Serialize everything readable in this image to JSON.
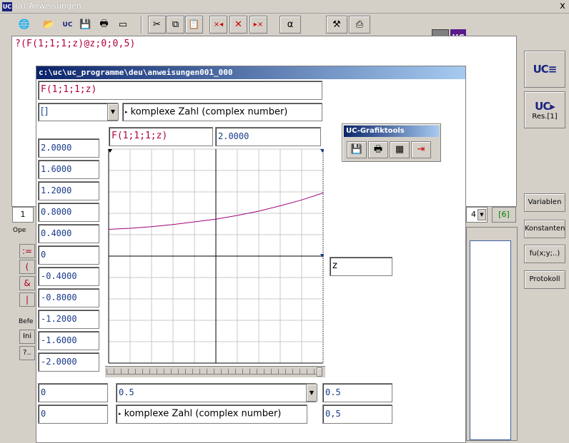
{
  "window": {
    "title": "(a):Anweisungen",
    "close": "x",
    "logo": "UC"
  },
  "toolbar": {
    "globe": "🌐",
    "open": "📂",
    "uc_open": "UC",
    "save": "💾",
    "print": "🖶",
    "screen": "▭",
    "cut": "✂",
    "copy": "⧉",
    "paste": "📋",
    "del_left": "×◂",
    "del_mid": "✕",
    "del_right": "▸×",
    "alpha": "α",
    "tools": "⚒",
    "cam": "⎙"
  },
  "expression": "?(F(1;1;1;z)@z;0;0,5)",
  "side": {
    "uc_top": "UC≡",
    "uc_res": "UC▸",
    "res_label": "Res.[1]",
    "variablen": "Variablen",
    "konstanten": "Konstanten",
    "fu": "fu(x;y;..)",
    "protokoll": "Protokoll"
  },
  "background": {
    "index": "1",
    "ope": "Ope",
    "befe": "Befe",
    "ini": "Ini",
    "q": "?..",
    "assign": ":=",
    "paren": "(",
    "amp": "&",
    "bar": "|",
    "combo_value": "4",
    "bracket6": "[6]"
  },
  "dialog": {
    "title": "c:\\uc\\uc_programme\\deu\\anweisungen001_000",
    "func": "F(1;1;1;z)",
    "type_combo": "[]",
    "type_desc": "komplexe Zahl (complex number)",
    "plot_func": "F(1;1;1;z)",
    "plot_value": "2.0000",
    "y_labels": [
      "2.0000",
      "1.6000",
      "1.2000",
      "0.8000",
      "0.4000",
      "0",
      "-0.4000",
      "-0.8000",
      "-1.2000",
      "-1.6000",
      "-2.0000"
    ],
    "x_var": "z",
    "xmin": "0",
    "xmax_combo": "0.5",
    "xmax": "0.5",
    "row2_left": "0",
    "row2_desc": "komplexe Zahl (complex number)",
    "row2_right": "0,5"
  },
  "grafiktools": {
    "title": "UC-Grafiktools",
    "save": "💾",
    "print": "🖶",
    "table": "▦",
    "exit": "⇥"
  },
  "colors": {
    "curve": "#a0007a",
    "grid": "#c8c8c8",
    "axis": "#000000",
    "accent": "#0a246a"
  },
  "chart_data": {
    "type": "line",
    "x": [
      0,
      0.05,
      0.1,
      0.15,
      0.2,
      0.25,
      0.3,
      0.35,
      0.4,
      0.45,
      0.5
    ],
    "series": [
      {
        "values": [
          0.5,
          0.52,
          0.55,
          0.59,
          0.64,
          0.69,
          0.76,
          0.84,
          0.94,
          1.05,
          1.18
        ]
      }
    ],
    "xlim": [
      0,
      0.5
    ],
    "ylim": [
      -2,
      2
    ],
    "grid": true
  }
}
